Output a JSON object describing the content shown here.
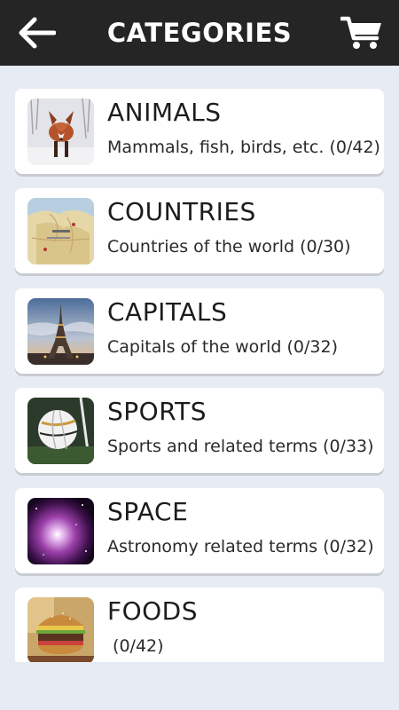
{
  "header": {
    "title": "CATEGORIES",
    "back_icon": "arrow-left-icon",
    "cart_icon": "shopping-cart-icon",
    "background": "#252525"
  },
  "categories": [
    {
      "name": "ANIMALS",
      "description": "Mammals, fish, birds, etc. (0/42)",
      "image": "fox-photo"
    },
    {
      "name": "COUNTRIES",
      "description": "Countries of the world (0/30)",
      "image": "map-photo"
    },
    {
      "name": "CAPITALS",
      "description": "Capitals of the world (0/32)",
      "image": "eiffel-tower-photo"
    },
    {
      "name": "SPORTS",
      "description": "Sports and related terms (0/33)",
      "image": "soccer-ball-photo"
    },
    {
      "name": "SPACE",
      "description": "Astronomy related terms (0/32)",
      "image": "nebula-photo"
    },
    {
      "name": "FOODS",
      "description": " (0/42)",
      "image": "burger-photo"
    }
  ]
}
